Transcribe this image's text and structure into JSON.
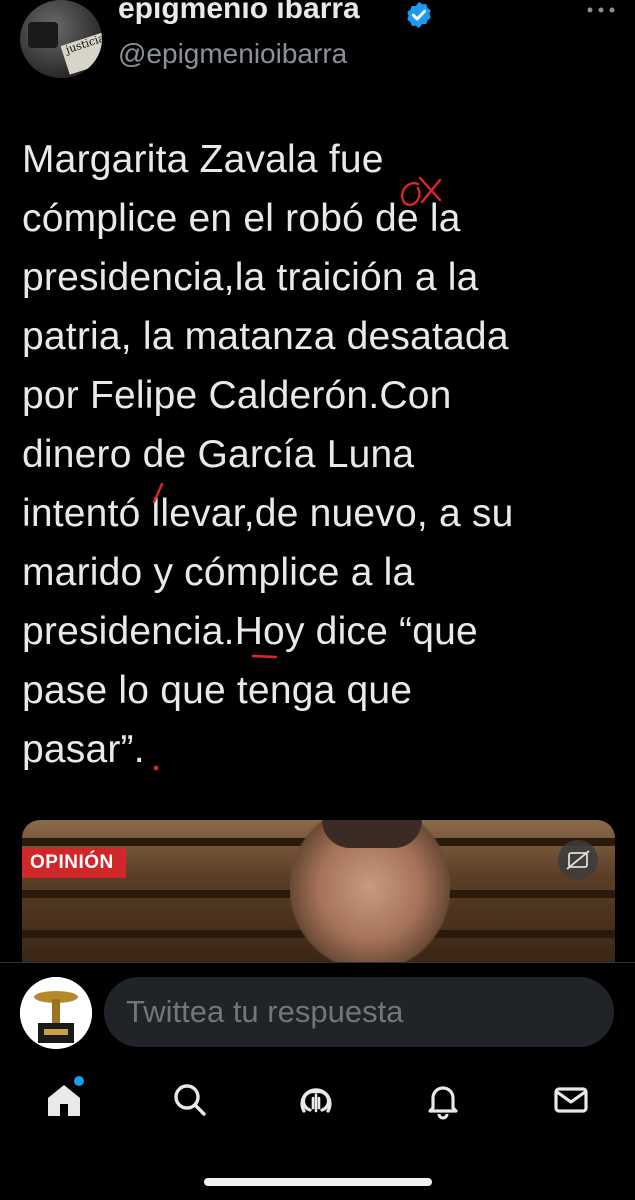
{
  "author": {
    "display_name": "epigmenio ibarra",
    "handle": "@epigmenioibarra",
    "avatar_sign": "justicia"
  },
  "tweet": {
    "lines": [
      "Margarita Zavala fue",
      "cómplice en el robó de la",
      "presidencia,la traición a la",
      "patria, la matanza desatada",
      "por Felipe Calderón.Con",
      "dinero de García Luna",
      "intentó llevar,de nuevo, a su",
      "marido y cómplice a la",
      "presidencia.Hoy dice “que",
      "pase lo que tenga que",
      "pasar”."
    ]
  },
  "media": {
    "badge": "OPINIÓN"
  },
  "reply": {
    "placeholder": "Twittea tu respuesta"
  },
  "tabs": [
    "home",
    "search",
    "spaces",
    "notifications",
    "messages"
  ],
  "colors": {
    "background": "#000000",
    "text": "#e7e9ea",
    "muted": "#8b9196",
    "accent": "#1d9bf0",
    "correction_red": "#e0252a",
    "badge_red": "#d0272a"
  }
}
